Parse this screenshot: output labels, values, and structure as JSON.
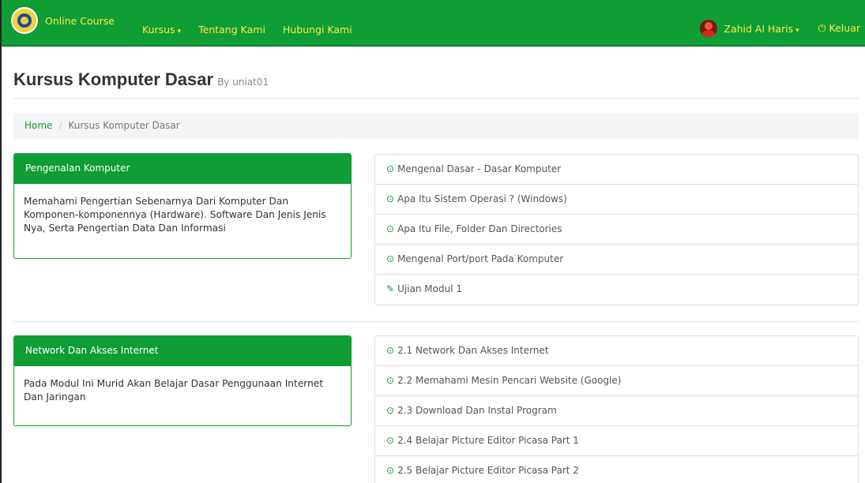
{
  "navbar": {
    "brand": "Online Course",
    "links": [
      {
        "label": "Kursus",
        "caret": "▾"
      },
      {
        "label": "Tentang Kami"
      },
      {
        "label": "Hubungi Kami"
      }
    ],
    "user": {
      "name": "Zahid Al Haris",
      "caret": "▾"
    },
    "logout": "Keluar",
    "color": "#0f9d36",
    "link_color": "#ffe94a"
  },
  "header": {
    "title": "Kursus Komputer Dasar",
    "by": "By uniat01"
  },
  "breadcrumb": {
    "home": "Home",
    "separator": "/",
    "current": "Kursus Komputer Dasar"
  },
  "modules": [
    {
      "title": "Pengenalan Komputer",
      "description": "Memahami Pengertian Sebenarnya Dari Komputer Dan Komponen-komponennya (Hardware). Software Dan Jenis Jenis Nya, Serta Pengertian Data Dan Informasi",
      "lessons": [
        {
          "label": "Mengenal Dasar - Dasar Komputer",
          "icon": "circle-arrow-icon"
        },
        {
          "label": "Apa Itu Sistem Operasi ? (Windows)",
          "icon": "circle-arrow-icon"
        },
        {
          "label": "Apa Itu File, Folder Dan Directories",
          "icon": "circle-arrow-icon"
        },
        {
          "label": "Mengenal Port/port Pada Komputer",
          "icon": "circle-arrow-icon"
        },
        {
          "label": "Ujian Modul 1",
          "icon": "edit-icon"
        }
      ]
    },
    {
      "title": "Network Dan Akses Internet",
      "description": "Pada Modul Ini Murid Akan Belajar Dasar Penggunaan Internet Dan Jaringan",
      "lessons": [
        {
          "label": "2.1 Network Dan Akses Internet",
          "icon": "circle-arrow-icon"
        },
        {
          "label": "2.2 Memahami Mesin Pencari Website (Google)",
          "icon": "circle-arrow-icon"
        },
        {
          "label": "2.3 Download Dan Instal Program",
          "icon": "circle-arrow-icon"
        },
        {
          "label": "2.4 Belajar Picture Editor Picasa Part 1",
          "icon": "circle-arrow-icon"
        },
        {
          "label": "2.5 Belajar Picture Editor Picasa Part 2",
          "icon": "circle-arrow-icon"
        }
      ]
    }
  ]
}
